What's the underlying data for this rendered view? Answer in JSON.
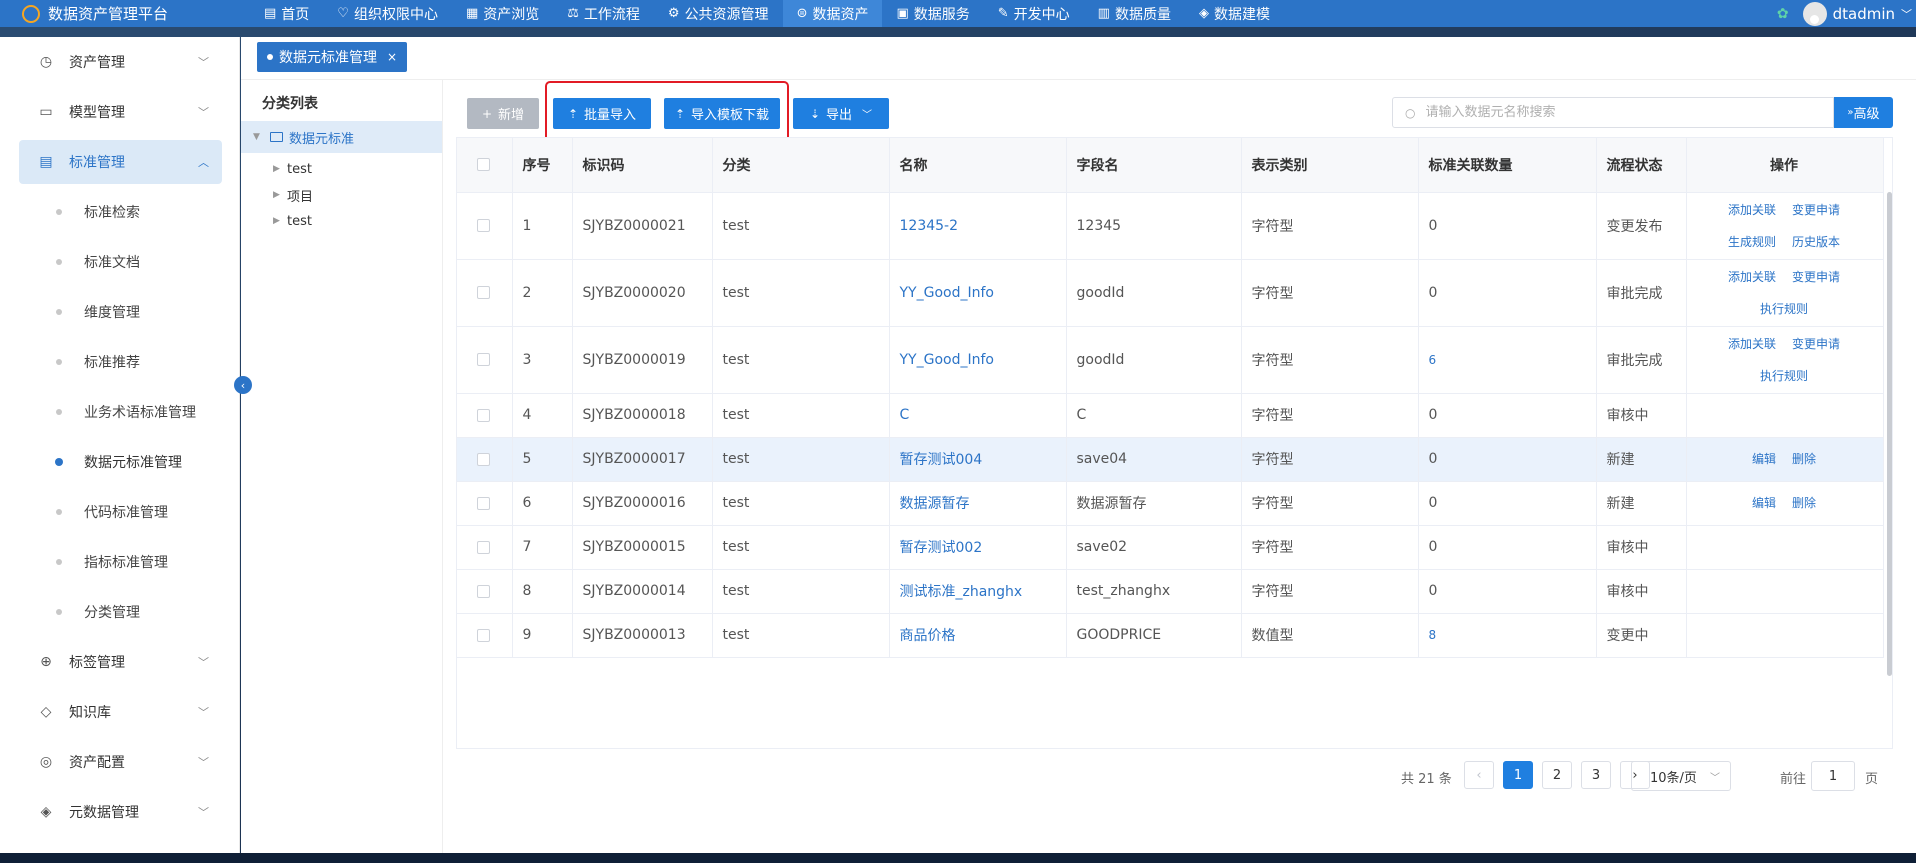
{
  "app": {
    "title": "数据资产管理平台"
  },
  "topnav": [
    {
      "label": "首页",
      "icon": "home-icon",
      "glyph": "▤"
    },
    {
      "label": "组织权限中心",
      "icon": "shield-icon",
      "glyph": "♡"
    },
    {
      "label": "资产浏览",
      "icon": "grid-icon",
      "glyph": "▦"
    },
    {
      "label": "工作流程",
      "icon": "flow-icon",
      "glyph": "⚖"
    },
    {
      "label": "公共资源管理",
      "icon": "resource-icon",
      "glyph": "⚙"
    },
    {
      "label": "数据资产",
      "icon": "asset-icon",
      "glyph": "⊜",
      "active": true
    },
    {
      "label": "数据服务",
      "icon": "service-icon",
      "glyph": "▣"
    },
    {
      "label": "开发中心",
      "icon": "edit-icon",
      "glyph": "✎"
    },
    {
      "label": "数据质量",
      "icon": "quality-icon",
      "glyph": "▥"
    },
    {
      "label": "数据建模",
      "icon": "layers-icon",
      "glyph": "◈"
    }
  ],
  "user": {
    "name": "dtadmin"
  },
  "sidebar": {
    "top": [
      {
        "label": "资产管理",
        "icon": "clock-icon",
        "glyph": "◷"
      },
      {
        "label": "模型管理",
        "icon": "model-icon",
        "glyph": "▭"
      }
    ],
    "open": {
      "label": "标准管理",
      "icon": "document-icon",
      "glyph": "▤"
    },
    "subitems": [
      {
        "label": "标准检索"
      },
      {
        "label": "标准文档"
      },
      {
        "label": "维度管理"
      },
      {
        "label": "标准推荐"
      },
      {
        "label": "业务术语标准管理"
      },
      {
        "label": "数据元标准管理",
        "active": true
      },
      {
        "label": "代码标准管理"
      },
      {
        "label": "指标标准管理"
      },
      {
        "label": "分类管理"
      }
    ],
    "bottom": [
      {
        "label": "标签管理",
        "icon": "plus-circle-icon",
        "glyph": "⊕"
      },
      {
        "label": "知识库",
        "icon": "tag-icon",
        "glyph": "◇"
      },
      {
        "label": "资产配置",
        "icon": "target-icon",
        "glyph": "◎"
      },
      {
        "label": "元数据管理",
        "icon": "stack-icon",
        "glyph": "◈"
      }
    ]
  },
  "tab": {
    "label": "数据元标准管理",
    "close": "×"
  },
  "tree": {
    "title": "分类列表",
    "root": "数据元标准",
    "children": [
      "test",
      "项目",
      "test"
    ]
  },
  "toolbar": {
    "add": "新增",
    "batch_import": "批量导入",
    "template_download": "导入模板下载",
    "export": "导出",
    "search_placeholder": "请输入数据元名称搜索",
    "advanced": "高级"
  },
  "table": {
    "headers": [
      "序号",
      "标识码",
      "分类",
      "名称",
      "字段名",
      "表示类别",
      "标准关联数量",
      "流程状态",
      "操作"
    ],
    "rows": [
      {
        "no": "1",
        "code": "SJYBZ0000021",
        "cat": "test",
        "name": "12345-2",
        "field": "12345",
        "type": "字符型",
        "count": "0",
        "count_link": false,
        "status": "变更发布",
        "ops": [
          [
            "添加关联",
            "变更申请"
          ],
          [
            "生成规则",
            "历史版本"
          ]
        ]
      },
      {
        "no": "2",
        "code": "SJYBZ0000020",
        "cat": "test",
        "name": "YY_Good_Info",
        "field": "goodId",
        "type": "字符型",
        "count": "0",
        "count_link": false,
        "status": "审批完成",
        "ops": [
          [
            "添加关联",
            "变更申请"
          ],
          [
            "执行规则"
          ]
        ]
      },
      {
        "no": "3",
        "code": "SJYBZ0000019",
        "cat": "test",
        "name": "YY_Good_Info",
        "field": "goodId",
        "type": "字符型",
        "count": "6",
        "count_link": true,
        "status": "审批完成",
        "ops": [
          [
            "添加关联",
            "变更申请"
          ],
          [
            "执行规则"
          ]
        ]
      },
      {
        "no": "4",
        "code": "SJYBZ0000018",
        "cat": "test",
        "name": "C",
        "field": "C",
        "type": "字符型",
        "count": "0",
        "count_link": false,
        "status": "审核中",
        "ops": []
      },
      {
        "no": "5",
        "code": "SJYBZ0000017",
        "cat": "test",
        "name": "暂存测试004",
        "field": "save04",
        "type": "字符型",
        "count": "0",
        "count_link": false,
        "status": "新建",
        "ops": [
          [
            "编辑",
            "删除"
          ]
        ],
        "highlight": true
      },
      {
        "no": "6",
        "code": "SJYBZ0000016",
        "cat": "test",
        "name": "数据源暂存",
        "field": "数据源暂存",
        "type": "字符型",
        "count": "0",
        "count_link": false,
        "status": "新建",
        "ops": [
          [
            "编辑",
            "删除"
          ]
        ]
      },
      {
        "no": "7",
        "code": "SJYBZ0000015",
        "cat": "test",
        "name": "暂存测试002",
        "field": "save02",
        "type": "字符型",
        "count": "0",
        "count_link": false,
        "status": "审核中",
        "ops": []
      },
      {
        "no": "8",
        "code": "SJYBZ0000014",
        "cat": "test",
        "name": "测试标准_zhanghx",
        "field": "test_zhanghx",
        "type": "字符型",
        "count": "0",
        "count_link": false,
        "status": "审核中",
        "ops": []
      },
      {
        "no": "9",
        "code": "SJYBZ0000013",
        "cat": "test",
        "name": "商品价格",
        "field": "GOODPRICE",
        "type": "数值型",
        "count": "8",
        "count_link": true,
        "status": "变更中",
        "ops": []
      }
    ]
  },
  "pagination": {
    "total": "共 21 条",
    "pages": [
      "1",
      "2",
      "3"
    ],
    "current": "1",
    "page_size": "10条/页",
    "goto_label": "前往",
    "goto_value": "1",
    "page_unit": "页"
  }
}
